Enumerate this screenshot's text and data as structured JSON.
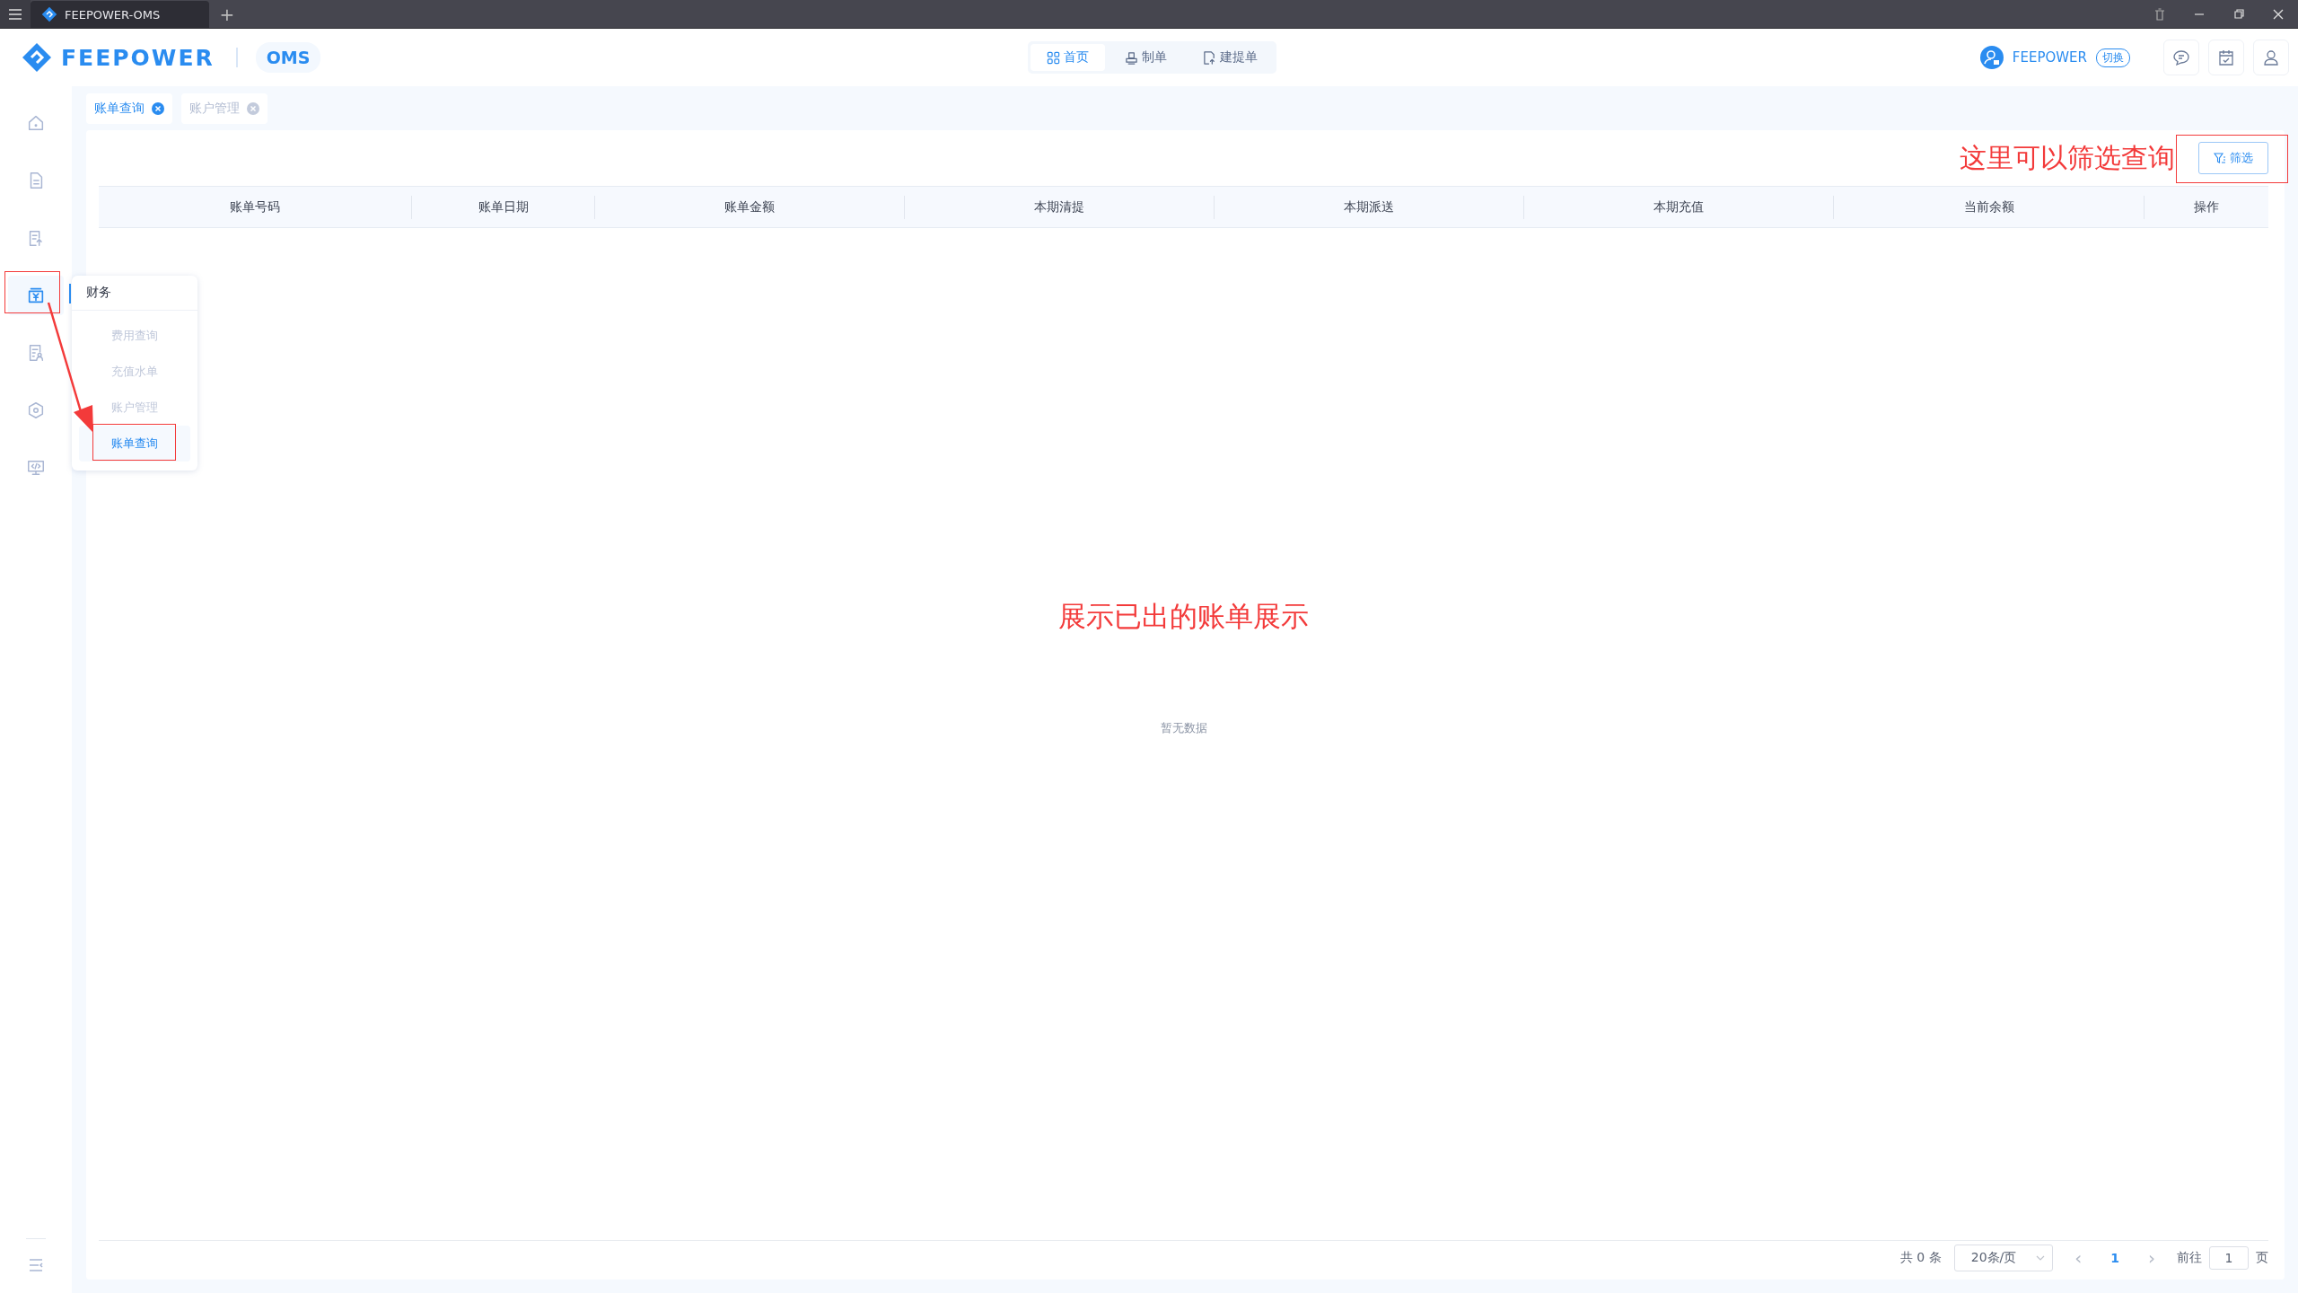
{
  "titlebar": {
    "tab_title": "FEEPOWER-OMS",
    "new_tab": "+"
  },
  "header": {
    "brand": "FEEPOWER",
    "product": "OMS",
    "nav": [
      {
        "label": "首页",
        "kind": "grid",
        "selected": true
      },
      {
        "label": "制单",
        "kind": "stamp",
        "selected": false
      },
      {
        "label": "建提单",
        "kind": "upload",
        "selected": false
      }
    ],
    "user": {
      "name": "FEEPOWER",
      "switch": "切换"
    }
  },
  "sidebar": {
    "items": [
      {
        "kind": "home",
        "selected": false
      },
      {
        "kind": "document",
        "selected": false
      },
      {
        "kind": "upload",
        "selected": false
      },
      {
        "kind": "finance",
        "selected": true
      },
      {
        "kind": "person",
        "selected": false
      },
      {
        "kind": "hexagon",
        "selected": false
      },
      {
        "kind": "monitor",
        "selected": false
      }
    ]
  },
  "flyout": {
    "title": "财务",
    "items": [
      {
        "label": "费用查询",
        "selected": false
      },
      {
        "label": "充值水单",
        "selected": false
      },
      {
        "label": "账户管理",
        "selected": false
      },
      {
        "label": "账单查询",
        "selected": true
      }
    ]
  },
  "page_tabs": [
    {
      "label": "账单查询",
      "selected": true
    },
    {
      "label": "账户管理",
      "selected": false
    }
  ],
  "filter_button": "筛选",
  "table": {
    "columns": [
      "账单号码",
      "账单日期",
      "账单金额",
      "本期清提",
      "本期派送",
      "本期充值",
      "当前余额",
      "操作"
    ],
    "empty_text": "暂无数据"
  },
  "pagination": {
    "total": "共 0 条",
    "page_size": "20条/页",
    "prev": "‹",
    "next": "›",
    "pages": [
      {
        "label": "1",
        "selected": true
      }
    ],
    "goto_label": "前往",
    "goto_value": "1",
    "goto_suffix": "页"
  },
  "annotations": [
    {
      "text": "这里可以筛选查询"
    },
    {
      "text": "展示已出的账单展示"
    }
  ]
}
